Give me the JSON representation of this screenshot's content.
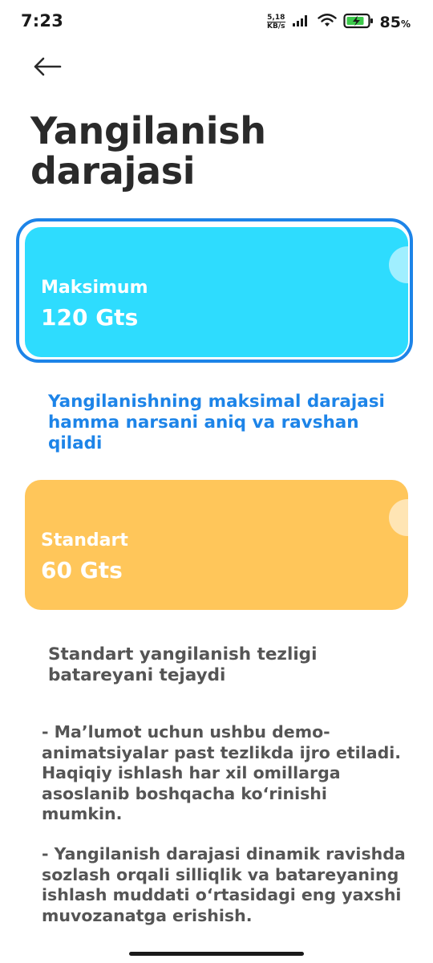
{
  "status_bar": {
    "time": "7:23",
    "net_speed_value": "5,18",
    "net_speed_unit": "KB/s",
    "battery_percent": "85",
    "battery_percent_sign": "%",
    "icons": [
      "signal-icon",
      "wifi-icon",
      "battery-charging-icon"
    ]
  },
  "header": {
    "back_icon": "arrow-left-icon",
    "title": "Yangilanish darajasi"
  },
  "options": [
    {
      "name": "Maksimum",
      "value": "120 Gts",
      "description": "Yangilanishning maksimal darajasi hamma narsani aniq va ravshan qiladi",
      "selected": true,
      "color": "#2edcfe"
    },
    {
      "name": "Standart",
      "value": "60 Gts",
      "description": "Standart yangilanish tezligi batareyani tejaydi",
      "selected": false,
      "color": "#ffc65a"
    }
  ],
  "notes": [
    "- Ma’lumot uchun ushbu demo-animatsiyalar past tezlikda ijro etiladi. Haqiqiy ishlash har xil omillarga asoslanib boshqacha ko‘rinishi mumkin.",
    "- Yangilanish darajasi dinamik ravishda sozlash orqali silliqlik va batareyaning ishlash muddati o‘rtasidagi eng yaxshi muvozanatga erishish."
  ],
  "colors": {
    "accent": "#1d84e8",
    "selected_border": "#1d84e8",
    "text_dark": "#2a2a2a",
    "text_muted": "#555555"
  }
}
